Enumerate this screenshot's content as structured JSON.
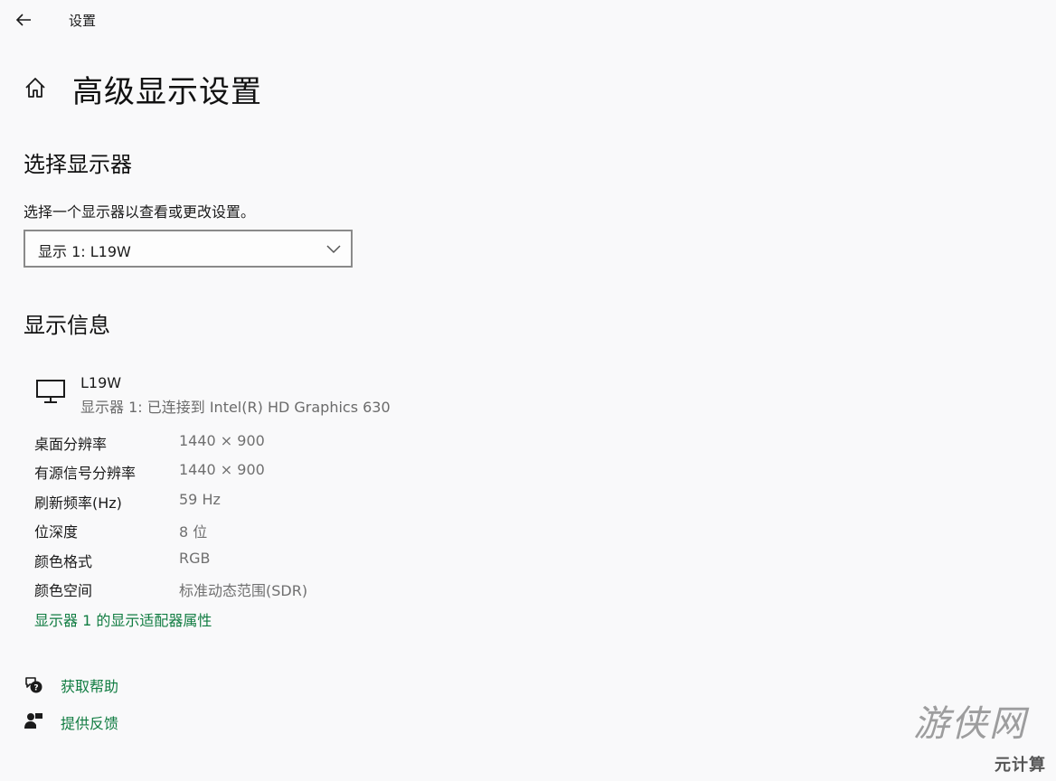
{
  "titlebar": {
    "back_icon": "back-arrow-icon",
    "app_title": "设置"
  },
  "page": {
    "home_icon": "home-icon",
    "title": "高级显示设置"
  },
  "select_display": {
    "heading": "选择显示器",
    "description": "选择一个显示器以查看或更改设置。",
    "dropdown_value": "显示 1: L19W",
    "dropdown_icon": "chevron-down-icon"
  },
  "display_info": {
    "heading": "显示信息",
    "monitor_icon": "monitor-icon",
    "monitor_name": "L19W",
    "monitor_sub": "显示器 1: 已连接到 Intel(R) HD Graphics 630",
    "rows": [
      {
        "label": "桌面分辨率",
        "value": "1440 × 900"
      },
      {
        "label": "有源信号分辨率",
        "value": "1440 × 900"
      },
      {
        "label": "刷新频率(Hz)",
        "value": "59 Hz"
      },
      {
        "label": "位深度",
        "value": "8 位"
      },
      {
        "label": "颜色格式",
        "value": "RGB"
      },
      {
        "label": "颜色空间",
        "value": "标准动态范围(SDR)"
      }
    ],
    "adapter_link": "显示器 1 的显示适配器属性"
  },
  "footer": {
    "help_icon": "help-chat-icon",
    "help_label": "获取帮助",
    "feedback_icon": "feedback-icon",
    "feedback_label": "提供反馈"
  },
  "watermark": {
    "line1": "游侠网",
    "line2": "元计算"
  },
  "colors": {
    "link": "#107c41",
    "background": "#f9f9fa",
    "secondary_text": "#707070"
  }
}
